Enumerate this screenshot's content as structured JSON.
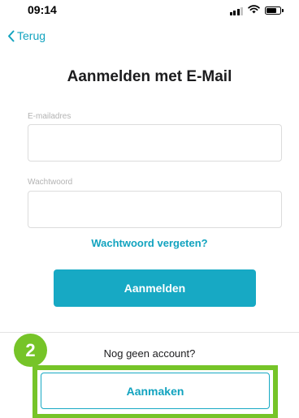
{
  "status_bar": {
    "time": "09:14",
    "icons": [
      "signal-icon",
      "wifi-icon",
      "battery-icon"
    ]
  },
  "nav": {
    "back_label": "Terug",
    "back_icon": "chevron-left-icon"
  },
  "title": "Aanmelden met E-Mail",
  "form": {
    "email": {
      "label": "E-mailadres",
      "value": ""
    },
    "password": {
      "label": "Wachtwoord",
      "value": ""
    },
    "forgot_password": "Wachtwoord vergeten?",
    "login_button": "Aanmelden"
  },
  "signup": {
    "step_number": "2",
    "no_account_text": "Nog geen account?",
    "create_button": "Aanmaken"
  },
  "colors": {
    "accent": "#17a9c4",
    "link": "#12a3bf",
    "highlight": "#76c428"
  }
}
